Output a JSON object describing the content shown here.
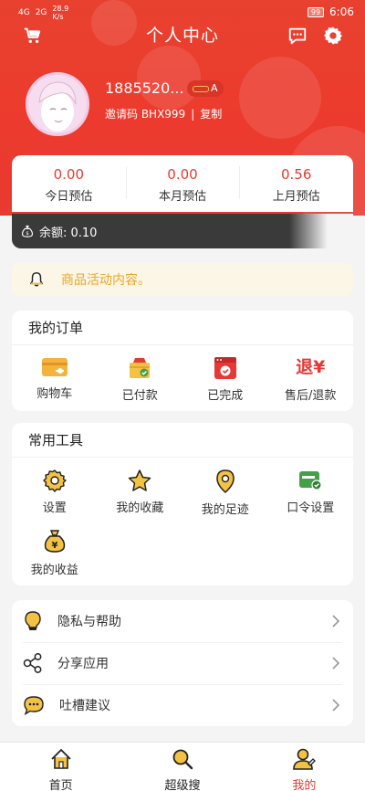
{
  "status_bar": {
    "left_signal_1": "4G",
    "left_signal_2": "2G",
    "net_speed": "28.9 K/s",
    "battery": "99",
    "time": "6:06"
  },
  "header": {
    "title": "个人中心",
    "cart_icon": "cart-icon",
    "message_icon": "message-icon",
    "settings_icon": "gear-icon"
  },
  "profile": {
    "username": "1885520...",
    "level": "A",
    "invite_label": "邀请码 BHX999",
    "separator": "|",
    "copy_label": "复制"
  },
  "stats": [
    {
      "value": "0.00",
      "label": "今日预估"
    },
    {
      "value": "0.00",
      "label": "本月预估"
    },
    {
      "value": "0.56",
      "label": "上月预估"
    }
  ],
  "balance": {
    "text": "余额: 0.10"
  },
  "notice": {
    "text": "商品活动内容。"
  },
  "orders": {
    "title": "我的订单",
    "items": [
      {
        "label": "购物车",
        "icon": "wallet-icon"
      },
      {
        "label": "已付款",
        "icon": "paid-box-icon"
      },
      {
        "label": "已完成",
        "icon": "completed-icon"
      },
      {
        "label": "售后/退款",
        "icon": "refund-icon",
        "glyph": "退¥"
      }
    ]
  },
  "tools": {
    "title": "常用工具",
    "items": [
      {
        "label": "设置",
        "icon": "gear-icon"
      },
      {
        "label": "我的收藏",
        "icon": "star-icon"
      },
      {
        "label": "我的足迹",
        "icon": "location-pin-icon"
      },
      {
        "label": "口令设置",
        "icon": "command-card-icon"
      },
      {
        "label": "我的收益",
        "icon": "money-bag-icon",
        "glyph": "¥"
      }
    ]
  },
  "menu": [
    {
      "label": "隐私与帮助",
      "icon": "lightbulb-icon"
    },
    {
      "label": "分享应用",
      "icon": "share-icon"
    },
    {
      "label": "吐槽建议",
      "icon": "chat-bubble-icon"
    }
  ],
  "tabbar": [
    {
      "label": "首页",
      "icon": "home-icon",
      "active": false
    },
    {
      "label": "超级搜",
      "icon": "search-icon",
      "active": false
    },
    {
      "label": "我的",
      "icon": "user-icon",
      "active": true
    }
  ],
  "colors": {
    "brand_red": "#e63b2e",
    "accent_yellow": "#f3c243",
    "notice_text": "#e8a72c",
    "balance_bar": "#3a3a3a"
  }
}
